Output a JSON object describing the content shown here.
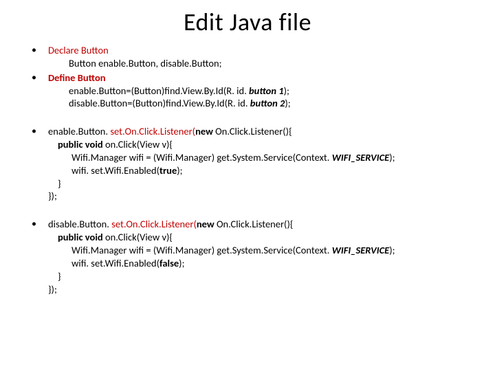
{
  "title": "Edit Java file",
  "bullets": {
    "b1_red": "Declare Button",
    "b1_line": "Button enable.Button, disable.Button;",
    "b2_red": "Define Button",
    "b2_line1_a": "enable.Button=(Button)find.View.By.Id(R. id. ",
    "b2_line1_b": "button 1",
    "b2_line1_c": ");",
    "b2_line2_a": "disable.Button=(Button)find.View.By.Id(R. id. ",
    "b2_line2_b": "button 2",
    "b2_line2_c": ");",
    "b3_l1_a": "enable.Button. ",
    "b3_l1_b": "set.On.Click.Listener(",
    "b3_l1_c": "new ",
    "b3_l1_d": "On.Click.Listener(){",
    "b3_l2_a": "public void ",
    "b3_l2_b": "on.Click(View v){",
    "b3_l3_a": "Wifi.Manager wifi = (Wifi.Manager) get.System.Service(Context. ",
    "b3_l3_b": "WIFI_SERVICE",
    "b3_l3_c": ");",
    "b3_l4_a": "wifi. set.Wifi.Enabled(",
    "b3_l4_b": "true",
    "b3_l4_c": ");",
    "b3_l5": "}",
    "b3_l6": "});",
    "b4_l1_a": "disable.Button. ",
    "b4_l1_b": "set.On.Click.Listener(",
    "b4_l1_c": "new ",
    "b4_l1_d": "On.Click.Listener(){",
    "b4_l2_a": "public void ",
    "b4_l2_b": "on.Click(View v){",
    "b4_l3_a": "Wifi.Manager wifi = (Wifi.Manager) get.System.Service(Context. ",
    "b4_l3_b": "WIFI_SERVICE",
    "b4_l3_c": ");",
    "b4_l4_a": "wifi. set.Wifi.Enabled(",
    "b4_l4_b": "false",
    "b4_l4_c": ");",
    "b4_l5": "}",
    "b4_l6": "});"
  }
}
